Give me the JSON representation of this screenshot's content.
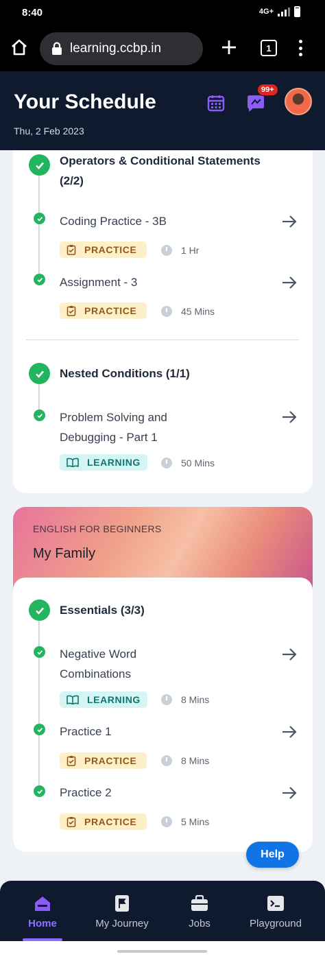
{
  "status_bar": {
    "time": "8:40",
    "network": "4G+"
  },
  "browser": {
    "url": "learning.ccbp.in",
    "tab_count": "1"
  },
  "header": {
    "title": "Your Schedule",
    "date": "Thu, 2 Feb 2023",
    "notification_badge": "99+"
  },
  "course1": {
    "sections": [
      {
        "topic": "Operators & Conditional Statements (2/2)",
        "items": [
          {
            "title": "Coding Practice - 3B",
            "tag": "PRACTICE",
            "duration": "1 Hr"
          },
          {
            "title": "Assignment - 3",
            "tag": "PRACTICE",
            "duration": "45 Mins"
          }
        ]
      },
      {
        "topic": "Nested Conditions (1/1)",
        "items": [
          {
            "title": "Problem Solving and Debugging - Part 1",
            "tag": "LEARNING",
            "duration": "50 Mins"
          }
        ]
      }
    ]
  },
  "course2": {
    "category": "ENGLISH FOR BEGINNERS",
    "name": "My Family",
    "sections": [
      {
        "topic": "Essentials (3/3)",
        "items": [
          {
            "title": "Negative Word Combinations",
            "tag": "LEARNING",
            "duration": "8 Mins"
          },
          {
            "title": "Practice 1",
            "tag": "PRACTICE",
            "duration": "8 Mins"
          },
          {
            "title": "Practice 2",
            "tag": "PRACTICE",
            "duration": "5 Mins"
          }
        ]
      }
    ]
  },
  "help_label": "Help",
  "nav": [
    {
      "label": "Home",
      "icon": "home-icon",
      "active": true
    },
    {
      "label": "My Journey",
      "icon": "flag-icon",
      "active": false
    },
    {
      "label": "Jobs",
      "icon": "briefcase-icon",
      "active": false
    },
    {
      "label": "Playground",
      "icon": "terminal-icon",
      "active": false
    }
  ],
  "colors": {
    "header_bg": "#0f1a2e",
    "check_green": "#22b45f",
    "practice_bg": "#fdefc6",
    "practice_text": "#96571a",
    "learning_bg": "#d4f5f4",
    "learning_text": "#0f7670",
    "help_blue": "#1274e4",
    "nav_active": "#8b72ff"
  }
}
